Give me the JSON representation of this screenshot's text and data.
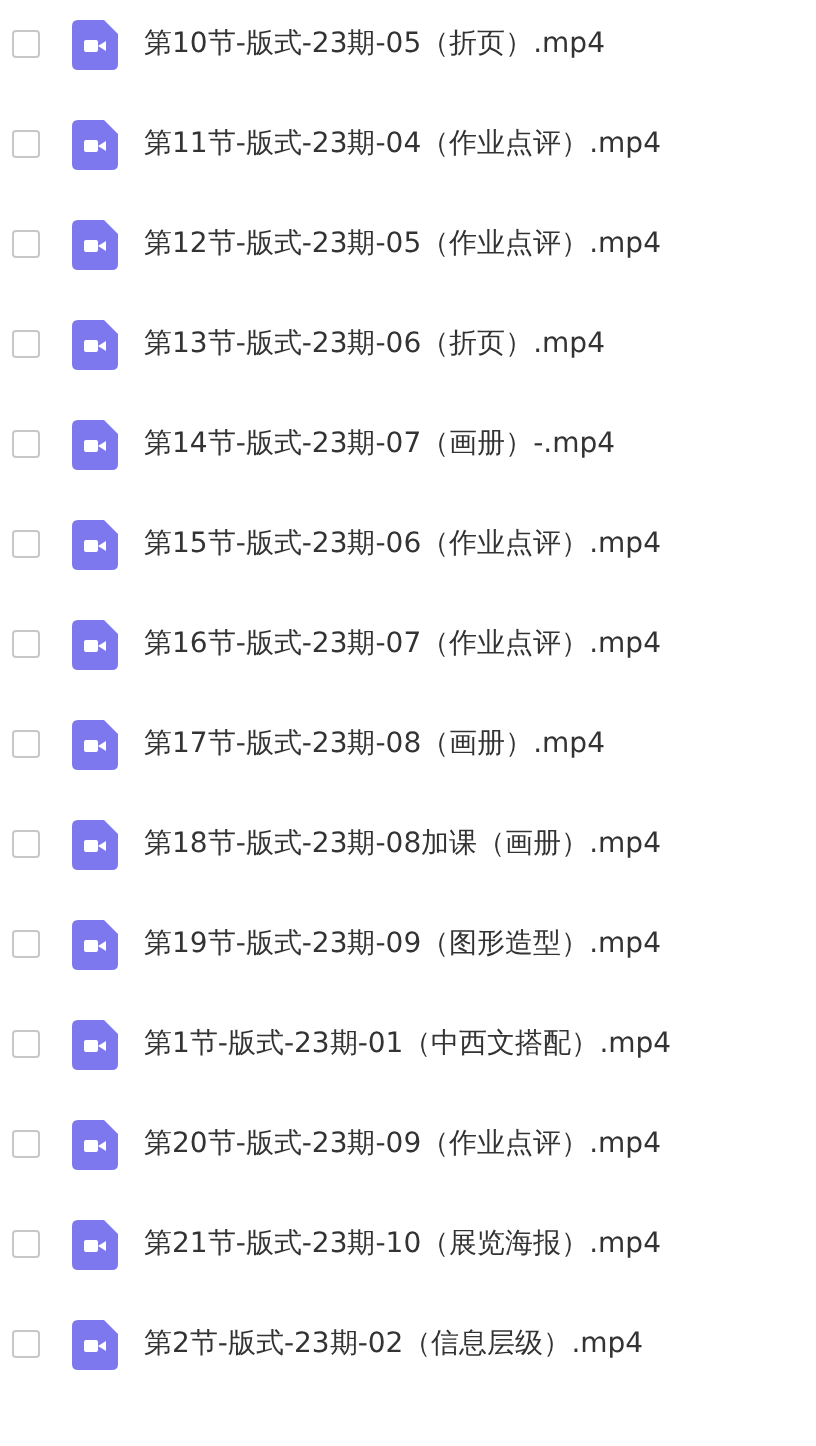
{
  "files": [
    {
      "name": "第10节-版式-23期-05（折页）.mp4",
      "checked": false
    },
    {
      "name": "第11节-版式-23期-04（作业点评）.mp4",
      "checked": false
    },
    {
      "name": "第12节-版式-23期-05（作业点评）.mp4",
      "checked": false
    },
    {
      "name": "第13节-版式-23期-06（折页）.mp4",
      "checked": false
    },
    {
      "name": "第14节-版式-23期-07（画册）-.mp4",
      "checked": false
    },
    {
      "name": "第15节-版式-23期-06（作业点评）.mp4",
      "checked": false
    },
    {
      "name": "第16节-版式-23期-07（作业点评）.mp4",
      "checked": false
    },
    {
      "name": "第17节-版式-23期-08（画册）.mp4",
      "checked": false
    },
    {
      "name": "第18节-版式-23期-08加课（画册）.mp4",
      "checked": false
    },
    {
      "name": "第19节-版式-23期-09（图形造型）.mp4",
      "checked": false
    },
    {
      "name": "第1节-版式-23期-01（中西文搭配）.mp4",
      "checked": false
    },
    {
      "name": "第20节-版式-23期-09（作业点评）.mp4",
      "checked": false
    },
    {
      "name": "第21节-版式-23期-10（展览海报）.mp4",
      "checked": false
    },
    {
      "name": "第2节-版式-23期-02（信息层级）.mp4",
      "checked": false
    }
  ]
}
